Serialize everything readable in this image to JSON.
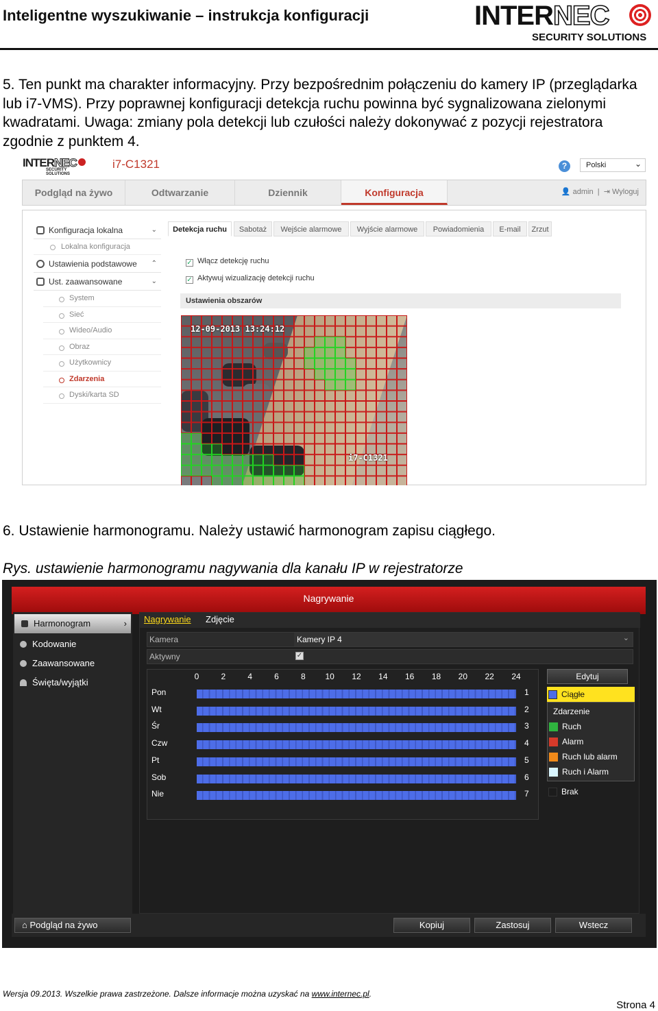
{
  "header": {
    "title": "Inteligentne wyszukiwanie – instrukcja konfiguracji",
    "logo_main": "INTER",
    "logo_nec": "NEC",
    "logo_sub": "SECURITY SOLUTIONS"
  },
  "paragraph5": "5. Ten punkt ma charakter informacyjny. Przy bezpośrednim połączeniu do kamery IP (przeglądarka lub i7-VMS). Przy poprawnej konfiguracji detekcja ruchu powinna być sygnalizowana zielonymi kwadratami. Uwaga: zmiany pola detekcji lub czułości należy dokonywać z pozycji rejestratora zgodnie z punktem 4.",
  "camera_ui": {
    "logo_main": "INTER",
    "logo_nec": "NEC",
    "logo_sub": "SECURITY SOLUTIONS",
    "model": "i7-C1321",
    "help": "?",
    "language": "Polski",
    "nav": [
      "Podgląd na żywo",
      "Odtwarzanie",
      "Dziennik",
      "Konfiguracja"
    ],
    "user": "admin",
    "logout": "Wyloguj",
    "sidebar": {
      "local": "Konfiguracja lokalna",
      "local_items": [
        "Lokalna konfiguracja"
      ],
      "basic": "Ustawienia podstawowe",
      "advanced": "Ust. zaawansowane",
      "advanced_items": [
        "System",
        "Sieć",
        "Wideo/Audio",
        "Obraz",
        "Użytkownicy",
        "Zdarzenia",
        "Dyski/karta SD"
      ]
    },
    "tabs": [
      "Detekcja ruchu",
      "Sabotaż",
      "Wejście alarmowe",
      "Wyjście alarmowe",
      "Powiadomienia",
      "E-mail",
      "Zrzut"
    ],
    "checkbox1": "Włącz detekcję ruchu",
    "checkbox2": "Aktywuj wizualizację detekcji ruchu",
    "areas_header": "Ustawienia obszarów",
    "timestamp": "12-09-2013 13:24:12",
    "camera_label": "i7-C1321",
    "colors": {
      "grid": "#c81818",
      "motion": "#22d422",
      "accent": "#c0392b"
    }
  },
  "heading6": "6. Ustawienie harmonogramu. Należy ustawić harmonogram zapisu ciągłego.",
  "caption": "Rys. ustawienie harmonogramu nagywania dla kanału IP w rejestratorze",
  "dvr": {
    "title": "Nagrywanie",
    "sidebar": [
      "Harmonogram",
      "Kodowanie",
      "Zaawansowane",
      "Święta/wyjątki"
    ],
    "tabs": [
      "Nagrywanie",
      "Zdjęcie"
    ],
    "camera_label": "Kamera",
    "camera_value": "Kamery IP 4",
    "active_label": "Aktywny",
    "active_checked": true,
    "hours": [
      "0",
      "2",
      "4",
      "6",
      "8",
      "10",
      "12",
      "14",
      "16",
      "18",
      "20",
      "22",
      "24"
    ],
    "days": [
      "Pon",
      "Wt",
      "Śr",
      "Czw",
      "Pt",
      "Sob",
      "Nie"
    ],
    "day_numbers": [
      "1",
      "2",
      "3",
      "4",
      "5",
      "6",
      "7"
    ],
    "edit_button": "Edytuj",
    "legend": {
      "continuous": "Ciągłe",
      "event": "Zdarzenie",
      "motion": "Ruch",
      "alarm": "Alarm",
      "motion_or_alarm": "Ruch lub alarm",
      "motion_and_alarm": "Ruch i Alarm",
      "none": "Brak"
    },
    "legend_colors": {
      "continuous": "#4d6de8",
      "motion": "#2fb33f",
      "alarm": "#d63a2a",
      "motion_or_alarm": "#f08a1a",
      "motion_and_alarm": "#d9f5ff",
      "none": "#1c1c1c"
    },
    "bottom": {
      "live": "Podgląd na żywo",
      "copy": "Kopiuj",
      "apply": "Zastosuj",
      "back": "Wstecz"
    }
  },
  "footer": {
    "text": "Wersja 09.2013. Wszelkie prawa zastrzeżone. Dalsze informacje można uzyskać na",
    "link": "www.internec.pl",
    "dot": "."
  },
  "page_number": "Strona 4"
}
